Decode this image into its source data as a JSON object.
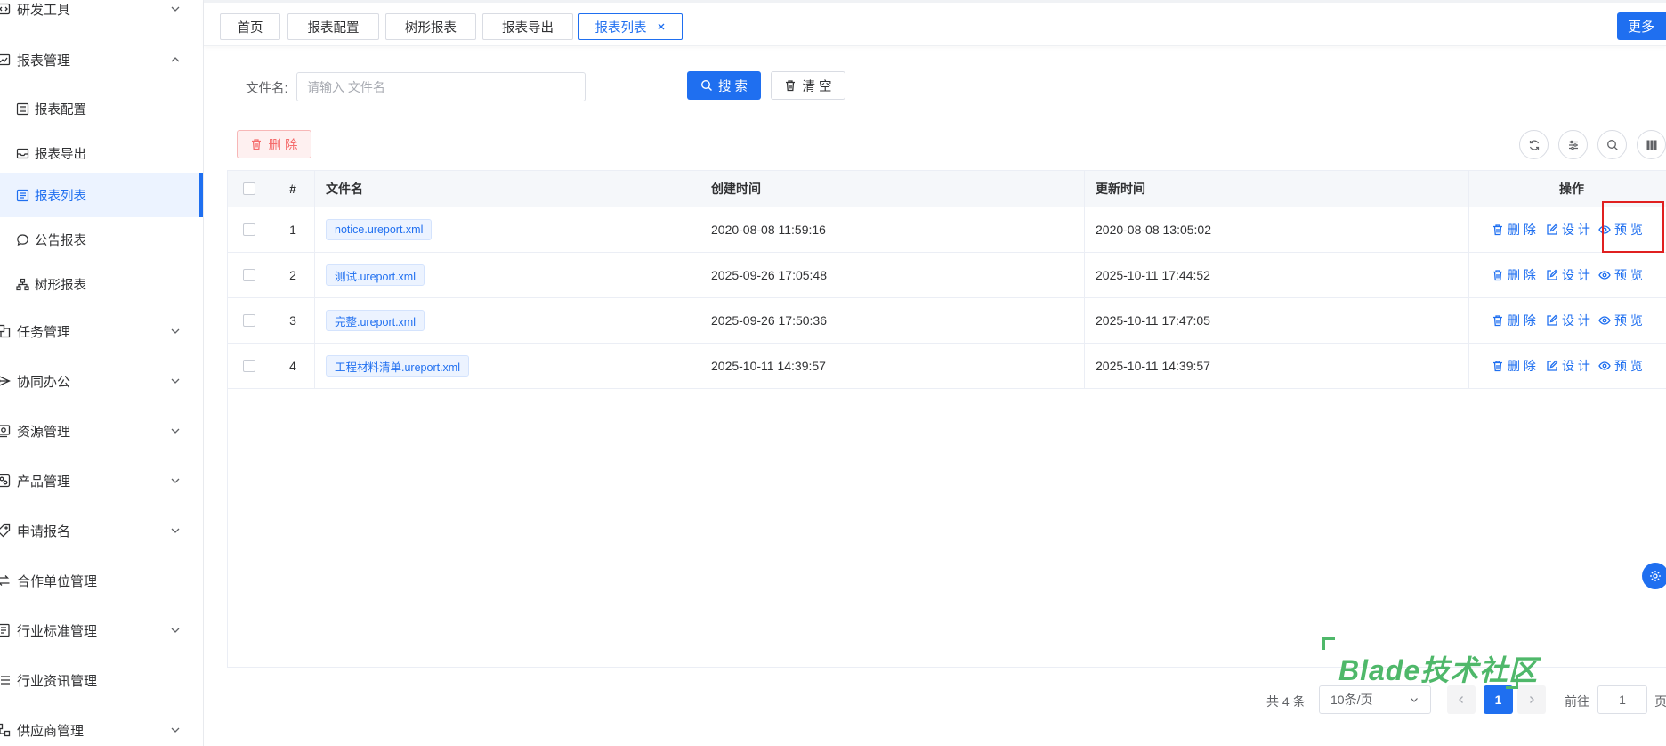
{
  "sidebar": {
    "top_partial": {
      "label": "研发工具",
      "icon": "code-icon"
    },
    "report_menu": {
      "label": "报表管理",
      "icon": "chart-icon"
    },
    "report_children": [
      {
        "label": "报表配置",
        "icon": "list-icon"
      },
      {
        "label": "报表导出",
        "icon": "tray-icon"
      },
      {
        "label": "报表列表",
        "icon": "document-icon",
        "active": true
      },
      {
        "label": "公告报表",
        "icon": "chat-bubble-icon"
      },
      {
        "label": "树形报表",
        "icon": "tree-icon"
      }
    ],
    "menus": [
      {
        "label": "任务管理",
        "icon": "tasks-icon",
        "expandable": true
      },
      {
        "label": "协同办公",
        "icon": "send-icon",
        "expandable": true
      },
      {
        "label": "资源管理",
        "icon": "resource-icon",
        "expandable": true
      },
      {
        "label": "产品管理",
        "icon": "product-icon",
        "expandable": true
      },
      {
        "label": "申请报名",
        "icon": "tag-icon",
        "expandable": true
      },
      {
        "label": "合作单位管理",
        "icon": "partner-icon",
        "expandable": false
      },
      {
        "label": "行业标准管理",
        "icon": "standard-icon",
        "expandable": true
      },
      {
        "label": "行业资讯管理",
        "icon": "news-icon",
        "expandable": false
      },
      {
        "label": "供应商管理",
        "icon": "supplier-icon",
        "expandable": true
      }
    ]
  },
  "tabs": [
    {
      "label": "首页"
    },
    {
      "label": "报表配置"
    },
    {
      "label": "树形报表"
    },
    {
      "label": "报表导出"
    },
    {
      "label": "报表列表",
      "active": true
    }
  ],
  "more_button": "更多",
  "search": {
    "label": "文件名:",
    "placeholder": "请输入 文件名",
    "search_button": "搜 索",
    "clear_button": "清 空"
  },
  "toolbar": {
    "delete_button": "删 除",
    "tools": [
      "refresh-icon",
      "filter-icon",
      "search-icon",
      "grid-icon"
    ]
  },
  "table": {
    "headers": {
      "index": "#",
      "name": "文件名",
      "created": "创建时间",
      "updated": "更新时间",
      "actions": "操作"
    },
    "rows": [
      {
        "index": "1",
        "name": "notice.ureport.xml",
        "created": "2020-08-08 11:59:16",
        "updated": "2020-08-08 13:05:02"
      },
      {
        "index": "2",
        "name": "测试.ureport.xml",
        "created": "2025-09-26 17:05:48",
        "updated": "2025-10-11 17:44:52"
      },
      {
        "index": "3",
        "name": "完整.ureport.xml",
        "created": "2025-09-26 17:50:36",
        "updated": "2025-10-11 17:47:05"
      },
      {
        "index": "4",
        "name": "工程材料清单.ureport.xml",
        "created": "2025-10-11 14:39:57",
        "updated": "2025-10-11 14:39:57"
      }
    ],
    "actions": {
      "delete": "删 除",
      "design": "设 计",
      "preview": "预 览"
    }
  },
  "pagination": {
    "total": "共 4 条",
    "page_size": "10条/页",
    "current_page": "1",
    "goto_label": "前往",
    "goto_value": "1",
    "page_suffix": "页"
  },
  "watermark": "Blade技术社区",
  "colors": {
    "primary": "#1f6ff0",
    "danger": "#f56c6c",
    "highlight": "#e02020",
    "watermark": "#4fb86a"
  }
}
